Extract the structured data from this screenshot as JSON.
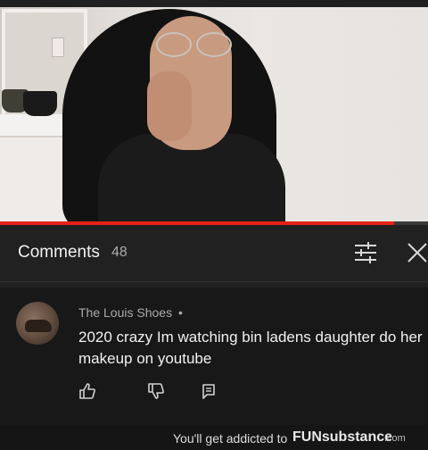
{
  "video": {
    "progress_fraction": 0.92,
    "progress_color": "#e62117"
  },
  "comments_header": {
    "title": "Comments",
    "count": "48",
    "filter_icon": "sort-filter-icon",
    "close_icon": "close-icon"
  },
  "comment": {
    "author": "The Louis Shoes",
    "separator": "•",
    "text": "2020 crazy Im watching bin ladens daughter do her makeup on youtube",
    "actions": [
      "thumbs-up-icon",
      "thumbs-down-icon",
      "reply-icon"
    ]
  },
  "watermark": {
    "text": "You'll get addicted to",
    "brand": "FUNsubstance",
    "suffix": ".com"
  }
}
